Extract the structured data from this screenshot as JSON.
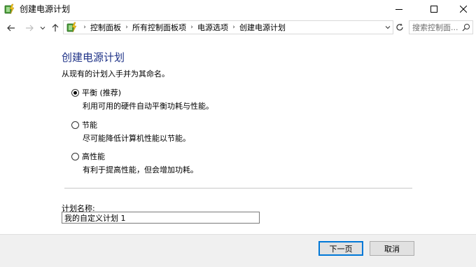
{
  "window": {
    "title": "创建电源计划",
    "controls": {
      "minimize": "minimize-icon",
      "maximize": "maximize-icon",
      "close": "close-icon"
    }
  },
  "nav": {
    "back_icon": "back-arrow-icon",
    "forward_icon": "forward-arrow-icon",
    "recent_icon": "chevron-down-icon",
    "up_icon": "up-arrow-icon",
    "breadcrumbs": [
      "控制面板",
      "所有控制面板项",
      "电源选项",
      "创建电源计划"
    ],
    "refresh_icon": "refresh-icon",
    "search_placeholder": "搜索控制面...",
    "search_icon": "search-icon"
  },
  "main": {
    "heading": "创建电源计划",
    "subtitle": "从现有的计划入手并为其命名。",
    "options": [
      {
        "label": "平衡 (推荐)",
        "description": "利用可用的硬件自动平衡功耗与性能。",
        "selected": true
      },
      {
        "label": "节能",
        "description": "尽可能降低计算机性能以节能。",
        "selected": false
      },
      {
        "label": "高性能",
        "description": "有利于提高性能，但会增加功耗。",
        "selected": false
      }
    ],
    "plan_name_label": "计划名称:",
    "plan_name_value": "我的自定义计划 1"
  },
  "footer": {
    "next_label": "下一页",
    "cancel_label": "取消"
  },
  "colors": {
    "heading": "#1e3287",
    "accent": "#0078d7",
    "footer_bg": "#f0f0f0"
  }
}
